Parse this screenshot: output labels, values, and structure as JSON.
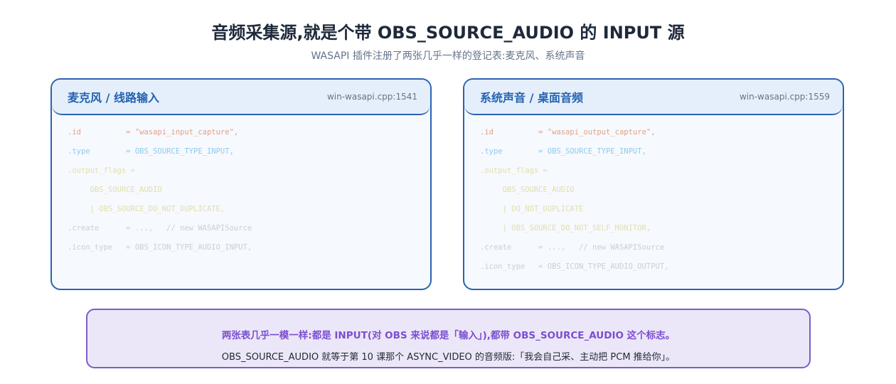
{
  "header": {
    "title": "音频采集源,就是个带 OBS_SOURCE_AUDIO 的 INPUT 源",
    "subtitle": "WASAPI 插件注册了两张几乎一样的登记表:麦克风、系统声音"
  },
  "panels": [
    {
      "title": "麦克风 / 线路输入",
      "ref": "win-wasapi.cpp:1541",
      "lines": [
        {
          "text": ".id          = \"wasapi_input_capture\",",
          "color": "orange"
        },
        {
          "text": ".type        = OBS_SOURCE_TYPE_INPUT,",
          "color": "blue"
        },
        {
          "text": ".output_flags =",
          "color": "yellow"
        },
        {
          "text": "     OBS_SOURCE_AUDIO",
          "color": "yellow"
        },
        {
          "text": "     | OBS_SOURCE_DO_NOT_DUPLICATE,",
          "color": "yellow"
        },
        {
          "text": ".create      = ...,   // new WASAPISource",
          "color": "gray"
        },
        {
          "text": ".icon_type   = OBS_ICON_TYPE_AUDIO_INPUT,",
          "color": "gray"
        }
      ]
    },
    {
      "title": "系统声音 / 桌面音频",
      "ref": "win-wasapi.cpp:1559",
      "lines": [
        {
          "text": ".id          = \"wasapi_output_capture\",",
          "color": "orange"
        },
        {
          "text": ".type        = OBS_SOURCE_TYPE_INPUT,",
          "color": "blue"
        },
        {
          "text": ".output_flags =",
          "color": "yellow"
        },
        {
          "text": "     OBS_SOURCE_AUDIO",
          "color": "yellow"
        },
        {
          "text": "     | DO_NOT_DUPLICATE",
          "color": "yellow"
        },
        {
          "text": "     | OBS_SOURCE_DO_NOT_SELF_MONITOR,",
          "color": "yellow"
        },
        {
          "text": ".create      = ...,   // new WASAPISource",
          "color": "gray"
        },
        {
          "text": ".icon_type   = OBS_ICON_TYPE_AUDIO_OUTPUT,",
          "color": "gray"
        }
      ]
    }
  ],
  "note": {
    "line1": "两张表几乎一模一样:都是 INPUT(对 OBS 来说都是「输入」),都带 OBS_SOURCE_AUDIO 这个标志。",
    "line2": "OBS_SOURCE_AUDIO 就等于第 10 课那个 ASYNC_VIDEO 的音频版:「我会自己采、主动把 PCM 推给你」。"
  },
  "colors": {
    "panel_border": "#2b63b5",
    "note_border": "#7c5cc8",
    "code_orange": "#e3a184",
    "code_blue": "#8fcbea",
    "code_yellow": "#e2dfa9",
    "code_gray": "#cbd0d6"
  }
}
